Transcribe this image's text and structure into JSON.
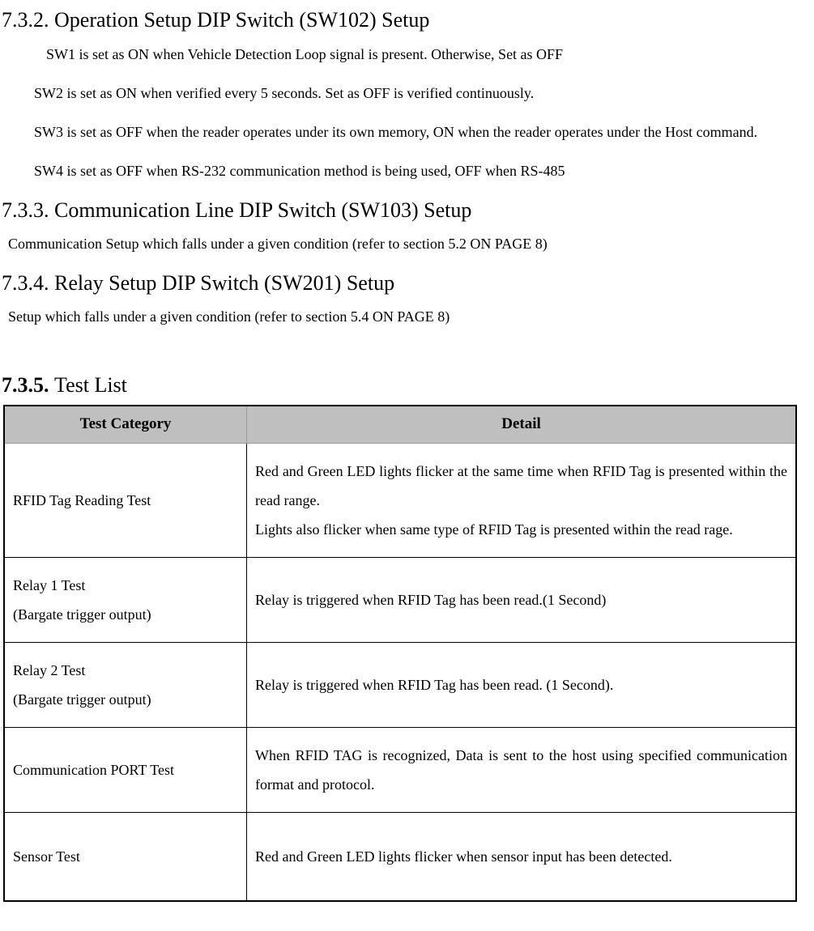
{
  "sections": {
    "s732": {
      "heading": "7.3.2. Operation Setup DIP Switch (SW102) Setup",
      "p1": "SW1 is set as ON when Vehicle Detection Loop signal is present. Otherwise, Set as OFF",
      "p2": "SW2 is set as ON when verified every 5 seconds.    Set as OFF is verified continuously.",
      "p3": "SW3 is set as OFF when the reader operates under its own memory, ON when the reader operates under the Host command.",
      "p4": "SW4 is set as OFF when RS-232 communication method is being used, OFF when RS-485"
    },
    "s733": {
      "heading": "7.3.3. Communication Line DIP Switch (SW103) Setup",
      "p1": "Communication Setup which falls under a given condition (refer to section 5.2 ON PAGE 8)"
    },
    "s734": {
      "heading": "7.3.4. Relay Setup DIP Switch (SW201) Setup",
      "p1": "Setup which falls under a given condition (refer to section 5.4 ON PAGE 8)"
    },
    "s735": {
      "heading_prefix": "7.3.5. ",
      "heading_rest": "Test List"
    }
  },
  "table": {
    "headers": {
      "col1": "Test Category",
      "col2": "Detail"
    },
    "rows": [
      {
        "category": "RFID Tag Reading Test",
        "detail": "Red and Green LED lights flicker at the same time when RFID Tag is presented within the read range.\nLights also flicker when same type of RFID Tag is presented within the read rage."
      },
      {
        "category": "Relay 1 Test\n(Bargate trigger output)",
        "detail": "Relay is triggered when RFID Tag has been read.(1 Second)"
      },
      {
        "category": "Relay 2 Test\n(Bargate trigger output)",
        "detail": "Relay is triggered when RFID Tag has been read. (1 Second)."
      },
      {
        "category": "Communication PORT Test",
        "detail": "When RFID TAG is recognized, Data is sent to the host using specified communication format and protocol."
      },
      {
        "category": "Sensor Test",
        "detail": "Red and Green LED lights flicker when sensor input has been detected."
      }
    ]
  }
}
